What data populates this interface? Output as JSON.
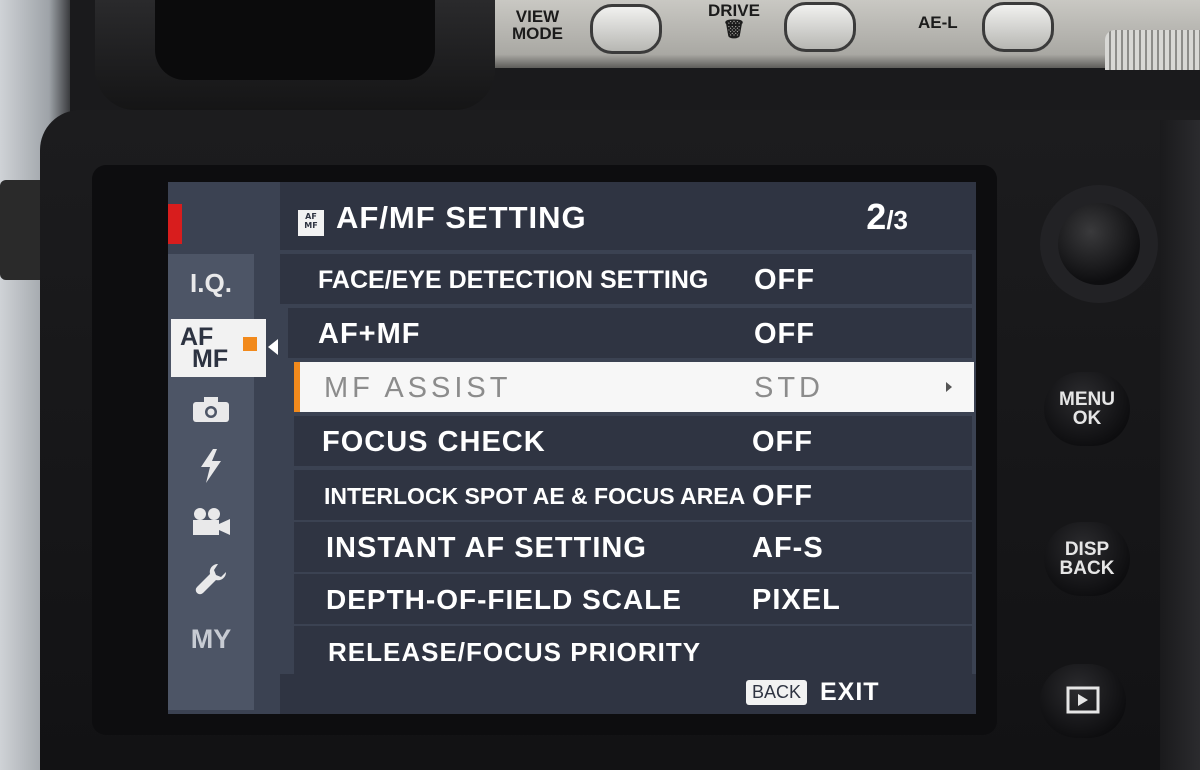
{
  "camera_buttons": {
    "view_mode_label_line1": "VIEW",
    "view_mode_label_line2": "MODE",
    "drive_label": "DRIVE",
    "drive_icon": "trash-icon",
    "ae_l_label": "AE-L",
    "menu_ok_line1": "MENU",
    "menu_ok_line2": "OK",
    "disp_back_line1": "DISP",
    "disp_back_line2": "BACK",
    "playback_icon": "play-icon"
  },
  "sidebar": {
    "items": [
      {
        "label": "I.Q.",
        "icon": "image-quality"
      },
      {
        "label_line1": "AF",
        "label_line2": "MF",
        "icon": "af-mf",
        "active": true
      },
      {
        "icon": "camera-icon"
      },
      {
        "icon": "flash-icon"
      },
      {
        "icon": "movie-camera-icon"
      },
      {
        "icon": "wrench-icon"
      },
      {
        "label": "MY",
        "icon": "my-menu"
      }
    ],
    "recording_indicator_color": "#d81d1d",
    "accent_color": "#f28a1c"
  },
  "header": {
    "icon_text_line1": "AF",
    "icon_text_line2": "MF",
    "title": "AF/MF SETTING",
    "page_current": "2",
    "page_total": "/3"
  },
  "menu": {
    "rows": [
      {
        "label": "FACE/EYE DETECTION SETTING",
        "value": "OFF"
      },
      {
        "label": "AF+MF",
        "value": "OFF"
      },
      {
        "label": "MF ASSIST",
        "value": "STD",
        "selected": true
      },
      {
        "label": "FOCUS CHECK",
        "value": "OFF"
      },
      {
        "label": "INTERLOCK SPOT AE & FOCUS AREA",
        "value": "OFF"
      },
      {
        "label": "INSTANT AF SETTING",
        "value": "AF-S"
      },
      {
        "label": "DEPTH-OF-FIELD SCALE",
        "value": "PIXEL"
      },
      {
        "label": "RELEASE/FOCUS PRIORITY",
        "value": ""
      }
    ]
  },
  "footer": {
    "back_key": "BACK",
    "exit_label": "EXIT"
  }
}
